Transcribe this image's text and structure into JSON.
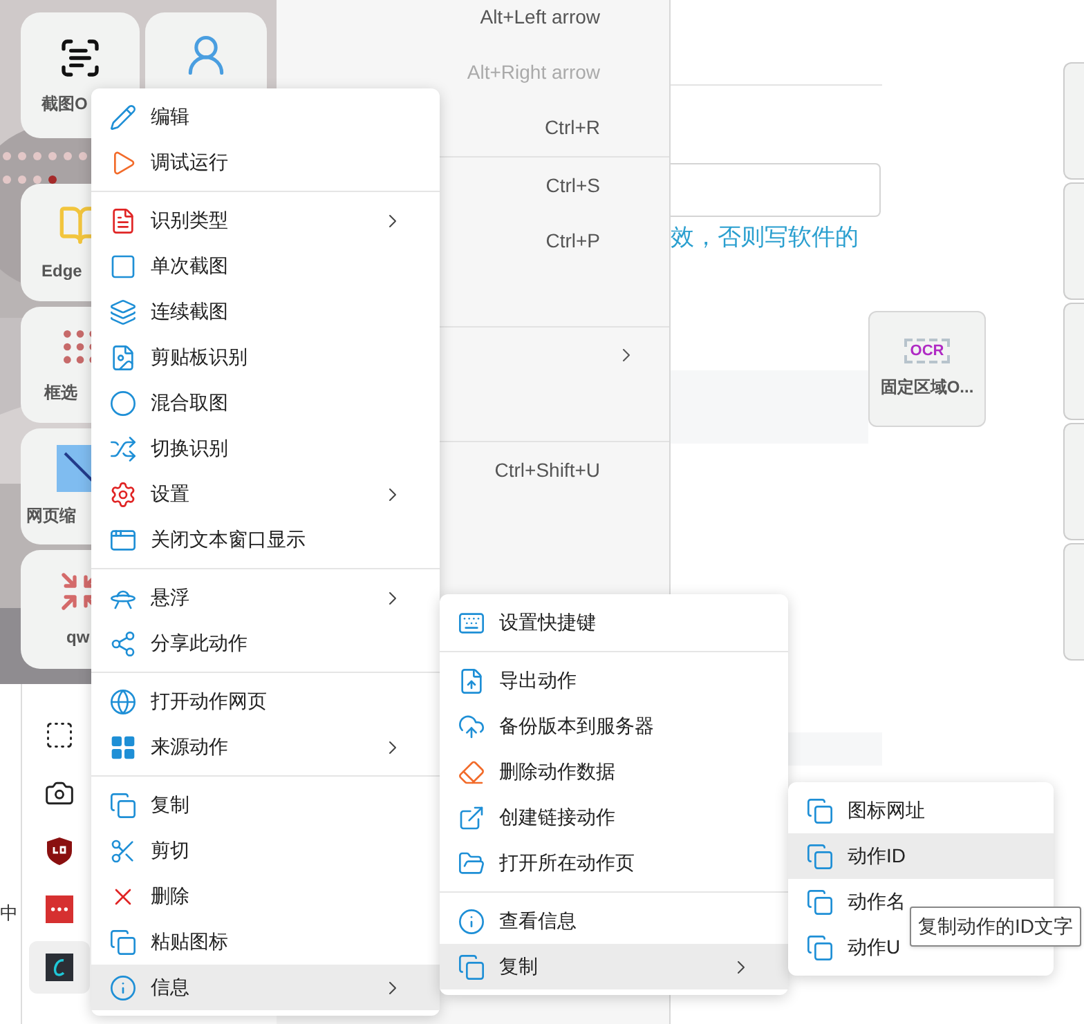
{
  "tiles": [
    {
      "label": "截图O"
    },
    {
      "label": "Edge"
    },
    {
      "label": "框选"
    },
    {
      "label": "网页缩"
    },
    {
      "label": "qw"
    }
  ],
  "pager_dots": [
    {
      "selected": false
    },
    {
      "selected": false
    },
    {
      "selected": false
    },
    {
      "selected": false
    },
    {
      "selected": false
    },
    {
      "selected": false
    },
    {
      "selected": false
    },
    {
      "selected": false
    },
    {
      "selected": false
    },
    {
      "selected": true
    }
  ],
  "side_text": "中",
  "extension_bar": [
    {
      "selected": false
    },
    {
      "selected": false
    },
    {
      "selected": false
    },
    {
      "selected": false
    },
    {
      "selected": true
    }
  ],
  "browser_menu": {
    "groups": [
      [
        {
          "shortcut": "Alt+Left arrow",
          "disabled": false
        },
        {
          "shortcut": "Alt+Right arrow",
          "disabled": true
        },
        {
          "shortcut": "Ctrl+R",
          "disabled": false
        }
      ],
      [
        {
          "shortcut": "Ctrl+S",
          "disabled": false
        },
        {
          "shortcut": "Ctrl+P",
          "disabled": false
        }
      ],
      [
        {
          "submenu": true
        }
      ],
      [
        {
          "shortcut": "Ctrl+Shift+U",
          "disabled": false
        }
      ]
    ]
  },
  "page": {
    "hint_text": "效，否则写软件的",
    "ocr_tile": {
      "icon_text": "OCR",
      "label": "固定区域O..."
    }
  },
  "context_menu": {
    "groups": [
      [
        {
          "label": "编辑",
          "submenu": false,
          "selected": false
        },
        {
          "label": "调试运行",
          "submenu": false,
          "selected": false
        }
      ],
      [
        {
          "label": "识别类型",
          "submenu": true,
          "selected": false
        },
        {
          "label": "单次截图",
          "submenu": false,
          "selected": false
        },
        {
          "label": "连续截图",
          "submenu": false,
          "selected": false
        },
        {
          "label": "剪贴板识别",
          "submenu": false,
          "selected": false
        },
        {
          "label": "混合取图",
          "submenu": false,
          "selected": false
        },
        {
          "label": "切换识别",
          "submenu": false,
          "selected": false
        },
        {
          "label": "设置",
          "submenu": true,
          "selected": false
        },
        {
          "label": "关闭文本窗口显示",
          "submenu": false,
          "selected": false
        }
      ],
      [
        {
          "label": "悬浮",
          "submenu": true,
          "selected": false
        },
        {
          "label": "分享此动作",
          "submenu": false,
          "selected": false
        }
      ],
      [
        {
          "label": "打开动作网页",
          "submenu": false,
          "selected": false
        },
        {
          "label": "来源动作",
          "submenu": true,
          "selected": false
        }
      ],
      [
        {
          "label": "复制",
          "submenu": false,
          "selected": false
        },
        {
          "label": "剪切",
          "submenu": false,
          "selected": false
        },
        {
          "label": "删除",
          "submenu": false,
          "selected": false
        },
        {
          "label": "粘贴图标",
          "submenu": false,
          "selected": false
        },
        {
          "label": "信息",
          "submenu": true,
          "selected": true
        }
      ]
    ]
  },
  "info_submenu": {
    "groups": [
      [
        {
          "label": "设置快捷键",
          "submenu": false,
          "selected": false
        }
      ],
      [
        {
          "label": "导出动作",
          "submenu": false,
          "selected": false
        },
        {
          "label": "备份版本到服务器",
          "submenu": false,
          "selected": false
        },
        {
          "label": "删除动作数据",
          "submenu": false,
          "selected": false
        },
        {
          "label": "创建链接动作",
          "submenu": false,
          "selected": false
        },
        {
          "label": "打开所在动作页",
          "submenu": false,
          "selected": false
        }
      ],
      [
        {
          "label": "查看信息",
          "submenu": false,
          "selected": false
        },
        {
          "label": "复制",
          "submenu": true,
          "selected": true
        }
      ]
    ]
  },
  "copy_submenu": {
    "groups": [
      [
        {
          "label": "图标网址",
          "submenu": false,
          "selected": false
        },
        {
          "label": "动作ID",
          "submenu": false,
          "selected": true
        },
        {
          "label": "动作名",
          "submenu": false,
          "selected": false
        },
        {
          "label": "动作U",
          "submenu": false,
          "selected": false
        }
      ]
    ]
  },
  "tooltip": "复制动作的ID文字"
}
